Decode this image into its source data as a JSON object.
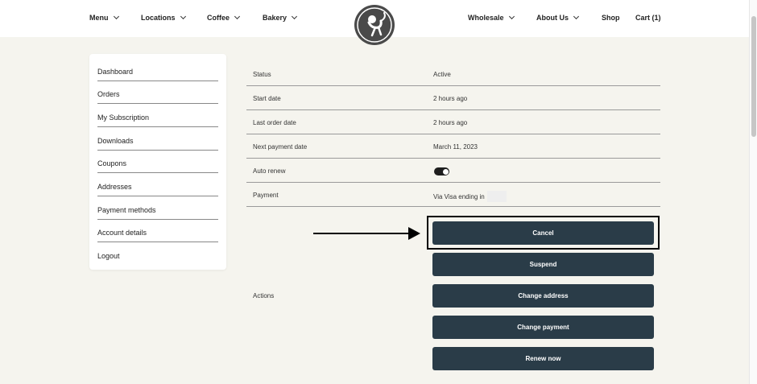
{
  "nav": {
    "left": [
      {
        "label": "Menu",
        "dropdown": true
      },
      {
        "label": "Locations",
        "dropdown": true
      },
      {
        "label": "Coffee",
        "dropdown": true
      },
      {
        "label": "Bakery",
        "dropdown": true
      }
    ],
    "right": [
      {
        "label": "Wholesale",
        "dropdown": true
      },
      {
        "label": "About Us",
        "dropdown": true
      },
      {
        "label": "Shop",
        "dropdown": false
      },
      {
        "label": "Cart (1)",
        "dropdown": false
      }
    ],
    "logo_icon": "monkey-logo-icon"
  },
  "sidebar": {
    "items": [
      {
        "label": "Dashboard"
      },
      {
        "label": "Orders"
      },
      {
        "label": "My Subscription"
      },
      {
        "label": "Downloads"
      },
      {
        "label": "Coupons"
      },
      {
        "label": "Addresses"
      },
      {
        "label": "Payment methods"
      },
      {
        "label": "Account details"
      },
      {
        "label": "Logout"
      }
    ]
  },
  "subscription": {
    "rows": [
      {
        "label": "Status",
        "value": "Active"
      },
      {
        "label": "Start date",
        "value": "2 hours ago"
      },
      {
        "label": "Last order date",
        "value": "2 hours ago"
      },
      {
        "label": "Next payment date",
        "value": "March 11, 2023"
      },
      {
        "label": "Auto renew",
        "value": "",
        "toggle_on": true
      },
      {
        "label": "Payment",
        "value": "Via Visa ending in"
      }
    ],
    "actions_label": "Actions",
    "actions": [
      {
        "label": "Cancel"
      },
      {
        "label": "Suspend"
      },
      {
        "label": "Change address"
      },
      {
        "label": "Change payment"
      },
      {
        "label": "Renew now"
      }
    ]
  },
  "colors": {
    "background": "#f5f4ee",
    "button": "#2a3c48",
    "logo": "#4a4a4a"
  }
}
